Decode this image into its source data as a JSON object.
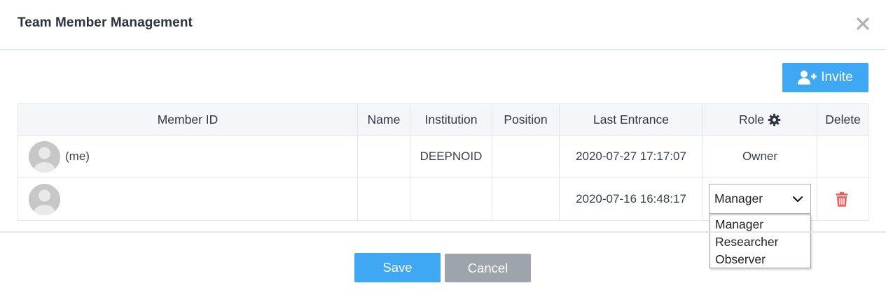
{
  "dialog": {
    "title": "Team Member Management",
    "close_icon": "close-icon"
  },
  "toolbar": {
    "invite_label": "Invite",
    "invite_icon": "user-plus-icon"
  },
  "table": {
    "columns": {
      "member_id": "Member ID",
      "name": "Name",
      "institution": "Institution",
      "position": "Position",
      "last_entrance": "Last Entrance",
      "role": "Role",
      "delete": "Delete"
    },
    "role_settings_icon": "gear-icon",
    "rows": [
      {
        "member_id": "(me)",
        "name": "",
        "institution": "DEEPNOID",
        "position": "",
        "last_entrance": "2020-07-27 17:17:07",
        "role": "Owner"
      },
      {
        "member_id": "",
        "name": "",
        "institution": "",
        "position": "",
        "last_entrance": "2020-07-16 16:48:17",
        "role": "Manager",
        "delete_icon": "trash-icon"
      }
    ]
  },
  "role_dropdown": {
    "selected": "Manager",
    "options": [
      "Manager",
      "Researcher",
      "Observer"
    ]
  },
  "footer": {
    "save_label": "Save",
    "cancel_label": "Cancel"
  },
  "colors": {
    "primary": "#3ea8f5",
    "secondary": "#9ea4ab",
    "danger": "#f05a5a",
    "avatar": "#c7c7c7"
  }
}
